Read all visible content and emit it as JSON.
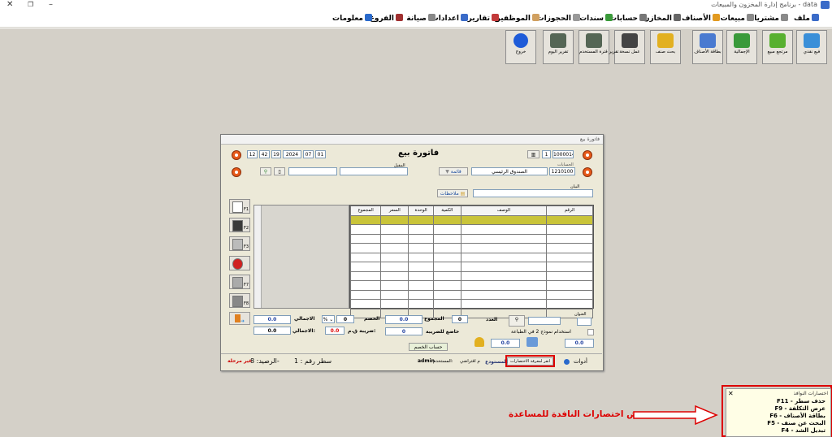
{
  "window": {
    "title": "برنامج إدارة المخزون والمبيعات - data"
  },
  "menu": [
    {
      "label": "ملف",
      "color": "#3a6bc8"
    },
    {
      "label": "مشتريات",
      "color": "#8a8a8a"
    },
    {
      "label": "مبيعات",
      "color": "#8a8a8a"
    },
    {
      "label": "الأصناف",
      "color": "#e29a20"
    },
    {
      "label": "المخازن",
      "color": "#666666"
    },
    {
      "label": "حسابات",
      "color": "#777777"
    },
    {
      "label": "سندات",
      "color": "#3a9a3a"
    },
    {
      "label": "الحجوزات",
      "color": "#999999"
    },
    {
      "label": "الموظفين",
      "color": "#d0a060"
    },
    {
      "label": "تقارير",
      "color": "#c23a3a"
    },
    {
      "label": "اعدادات",
      "color": "#3a6bc8"
    },
    {
      "label": "صيانة",
      "color": "#888888"
    },
    {
      "label": "الفروع",
      "color": "#a03030"
    },
    {
      "label": "معلومات",
      "color": "#2a6acc"
    }
  ],
  "toolbar": [
    {
      "label": "فيع نقدي",
      "color": "#3a8fd8"
    },
    {
      "label": "مرتجع مبيع",
      "color": "#58b030"
    },
    {
      "label": "الإجمالية",
      "color": "#3a9a3a"
    },
    {
      "label": "بطاقة الأصناف",
      "color": "#4a7ad0"
    },
    {
      "label": "بحث صنف",
      "color": "#e2b020"
    },
    {
      "label": "عمل نسخة",
      "color": "#444444"
    },
    {
      "label": "تقرير قترة المستخدم",
      "color": "#556655"
    },
    {
      "label": "تقرير اليوم",
      "color": "#556655"
    },
    {
      "label": "خروج",
      "color": "#1e5bd8"
    }
  ],
  "dialog": {
    "caption": "فاتورة بيع",
    "title": "فاتورة بيع",
    "invoice_no": "1000014",
    "copy_no": "1",
    "date_day": "01",
    "date_month": "07",
    "date_year": "2024",
    "time_h": "19",
    "time_m": "42",
    "time_s": "12",
    "account_label": "الحسابات",
    "account_code": "1210100",
    "account_name": "الصندوق الرئيسي",
    "list_btn": "قائمة",
    "discount_label": "المقيل",
    "statement_label": "البيان",
    "notes_btn": "ملاحظات",
    "grid_headers": [
      "الرقم",
      "الوصف",
      "الكمية",
      "الوحدة",
      "السعر",
      "المجموع"
    ],
    "side_keys": [
      "F1",
      "F2",
      "F3",
      "",
      "F7",
      "F8"
    ],
    "labels": {
      "count": "العدد",
      "sum": "المجموع",
      "discount": "الخصم",
      "total": "الاجمالي",
      "taxable": "خاضع للضريبة",
      "vat": "ضريبة ق.م:",
      "grand": "الاجمالي:",
      "print2": "استخدام نموذج 2 في الطباعة",
      "calc": "حساب الخصم",
      "address": "العنوان"
    },
    "values": {
      "count": "0",
      "sum": "0.0",
      "discount": "0",
      "pct": "%",
      "total": "0.0",
      "taxable": "0",
      "vat": "0.0",
      "grand": "0.0",
      "box1": "0.0",
      "box2": "0.0"
    },
    "status": {
      "tools": "أدوات",
      "shortcut_btn": "انقر لمعرفة الاختصارات",
      "warehouse": "المستودع",
      "wh_value": "م افتراضي",
      "user_label": "المستخدم:",
      "user": "admin",
      "line": "سطر رقم : 1",
      "balance": "الرصيد: 8-",
      "nostage": "غير مرحلة"
    }
  },
  "annotation": {
    "text": "عرض اختصارات النافدة للمساعدة"
  },
  "help_panel": {
    "title": "اختصارات النوافذ",
    "items": [
      {
        "key": "F11",
        "text": "حذف سطر"
      },
      {
        "key": "F9",
        "text": "عرض التكلفة"
      },
      {
        "key": "F6",
        "text": "بطاقة الأصناف"
      },
      {
        "key": "F5",
        "text": "البحث عن صنف"
      },
      {
        "key": "F4",
        "text": "تبديل الشد"
      }
    ]
  }
}
